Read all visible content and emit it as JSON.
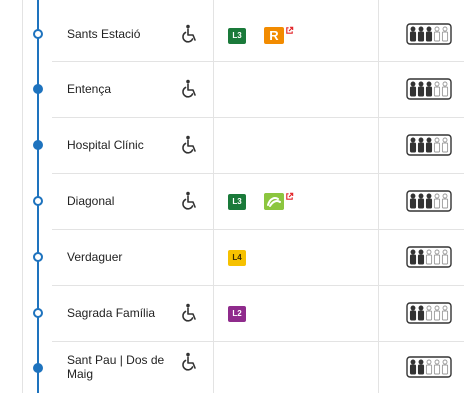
{
  "stations": [
    {
      "name": "Sants Estació",
      "dot": "open",
      "accessible": true,
      "connections": [
        {
          "type": "metro",
          "label": "L3",
          "color": "#1a7a3a",
          "external": false
        },
        {
          "type": "rodalies",
          "label": "R",
          "color": "#f28b00",
          "external": true
        }
      ],
      "occupancy": {
        "level": 3,
        "of": 5
      }
    },
    {
      "name": "Entença",
      "dot": "filled",
      "accessible": true,
      "connections": [],
      "occupancy": {
        "level": 3,
        "of": 5
      }
    },
    {
      "name": "Hospital Clínic",
      "dot": "filled",
      "accessible": true,
      "connections": [],
      "occupancy": {
        "level": 3,
        "of": 5
      }
    },
    {
      "name": "Diagonal",
      "dot": "open",
      "accessible": true,
      "connections": [
        {
          "type": "metro",
          "label": "L3",
          "color": "#1a7a3a",
          "external": false
        },
        {
          "type": "fgc",
          "label": "",
          "color": "#8cc63f",
          "external": true
        }
      ],
      "occupancy": {
        "level": 3,
        "of": 5
      }
    },
    {
      "name": "Verdaguer",
      "dot": "open",
      "accessible": false,
      "connections": [
        {
          "type": "metro",
          "label": "L4",
          "color": "#f6c100",
          "external": false
        }
      ],
      "occupancy": {
        "level": 2,
        "of": 5
      }
    },
    {
      "name": "Sagrada Família",
      "dot": "open",
      "accessible": true,
      "connections": [
        {
          "type": "metro",
          "label": "L2",
          "color": "#8f2b8c",
          "external": false
        }
      ],
      "occupancy": {
        "level": 2,
        "of": 5
      }
    },
    {
      "name": "Sant Pau | Dos de Maig",
      "dot": "filled",
      "accessible": true,
      "connections": [],
      "occupancy": {
        "level": 2,
        "of": 5
      }
    }
  ],
  "colors": {
    "line": "#1e73be",
    "external_link": "#e3262b"
  },
  "icons": {
    "accessible": "wheelchair-icon",
    "occupancy": "occupancy-people-icon",
    "external": "external-link-icon"
  }
}
